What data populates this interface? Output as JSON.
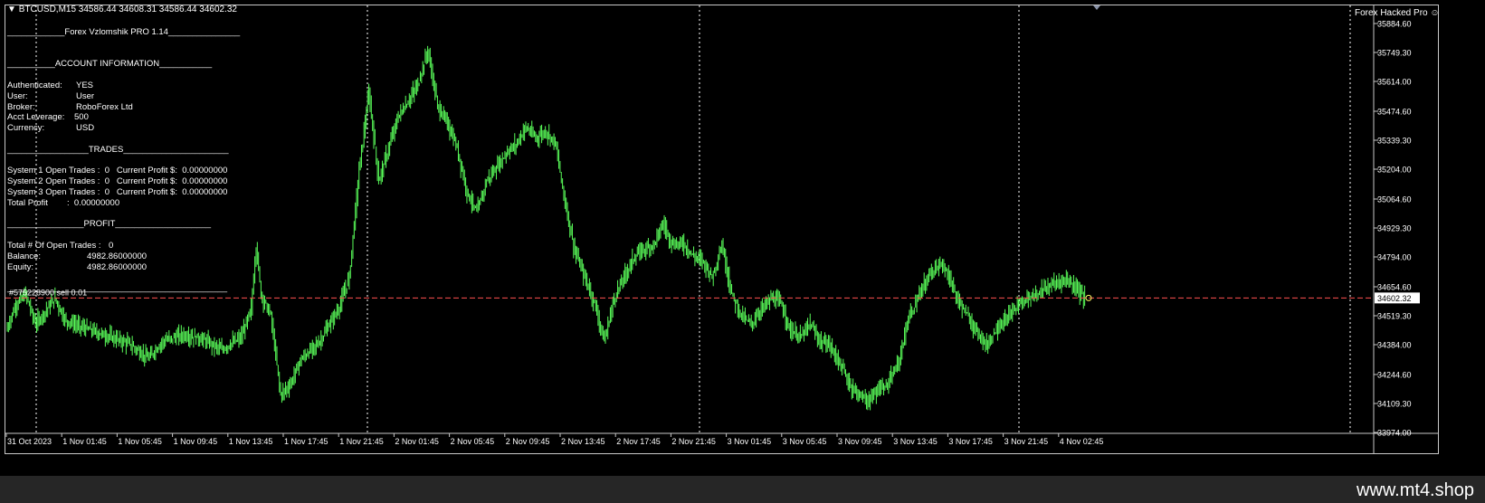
{
  "header": {
    "symbol_line": "BTCUSD,M15  34586.44 34608.31 34586.44 34602.32",
    "indicator_name": "Forex Hacked Pro",
    "indicator_icon": "smiley-icon"
  },
  "panel": {
    "title_line": "____________Forex Vzlomshik PRO 1.14_______________",
    "account_header": "__________ACCOUNT INFORMATION___________",
    "account": [
      {
        "label": "Authenticated:",
        "value": "YES"
      },
      {
        "label": "User:",
        "value": "User"
      },
      {
        "label": "Broker:",
        "value": "RoboForex Ltd"
      },
      {
        "label": "Acct Leverage:",
        "value": "500"
      },
      {
        "label": "Currency:",
        "value": "USD"
      }
    ],
    "trades_header": "_________________TRADES______________________",
    "trades": [
      "System 1 Open Trades :  0   Current Profit $:  0.00000000",
      "System 2 Open Trades :  0   Current Profit $:  0.00000000",
      "System 3 Open Trades :  0   Current Profit $:  0.00000000",
      "Total Profit        :  0.00000000"
    ],
    "profit_header": "________________PROFIT____________________",
    "profit": [
      {
        "label": "Total # Of Open Trades :",
        "value": "0"
      },
      {
        "label": "Balance:",
        "value": "4982.86000000"
      },
      {
        "label": "Equity:",
        "value": "4982.86000000"
      }
    ],
    "bottom_rule": "______________________________________________"
  },
  "order": {
    "label": "#575228900 sell 0.01",
    "price": 34602.32,
    "price_label": "34602.32",
    "line_color": "#ff5050"
  },
  "colors": {
    "background": "#000000",
    "candle": "#5aff5a",
    "grid_separator": "#ffffff",
    "price_tag_bg": "#ffffff",
    "footer_bg": "#262626"
  },
  "price_axis": {
    "ticks": [
      "35884.60",
      "35749.30",
      "35614.00",
      "35474.60",
      "35339.30",
      "35204.00",
      "35064.60",
      "34929.30",
      "34794.00",
      "34654.60",
      "34519.30",
      "34384.00",
      "34244.60",
      "34109.30",
      "33974.00"
    ],
    "min": 33974.0,
    "max": 35884.6
  },
  "time_axis": {
    "labels": [
      "31 Oct 2023",
      "1 Nov 01:45",
      "1 Nov 05:45",
      "1 Nov 09:45",
      "1 Nov 13:45",
      "1 Nov 17:45",
      "1 Nov 21:45",
      "2 Nov 01:45",
      "2 Nov 05:45",
      "2 Nov 09:45",
      "2 Nov 13:45",
      "2 Nov 17:45",
      "2 Nov 21:45",
      "3 Nov 01:45",
      "3 Nov 05:45",
      "3 Nov 09:45",
      "3 Nov 13:45",
      "3 Nov 17:45",
      "3 Nov 21:45",
      "4 Nov 02:45"
    ],
    "day_separators": [
      "1 Nov",
      "2 Nov",
      "3 Nov",
      "4 Nov",
      "5 Nov"
    ]
  },
  "chart_data": {
    "type": "line",
    "title": "BTCUSD,M15",
    "y_range": [
      33974.0,
      35884.6
    ],
    "x_start": "31 Oct 2023",
    "x_end": "4 Nov 02:45",
    "price_path": [
      [
        0,
        34450
      ],
      [
        4,
        34570
      ],
      [
        8,
        34620
      ],
      [
        12,
        34480
      ],
      [
        16,
        34540
      ],
      [
        20,
        34600
      ],
      [
        24,
        34500
      ],
      [
        30,
        34470
      ],
      [
        40,
        34430
      ],
      [
        50,
        34390
      ],
      [
        58,
        34320
      ],
      [
        64,
        34400
      ],
      [
        72,
        34430
      ],
      [
        80,
        34410
      ],
      [
        88,
        34360
      ],
      [
        96,
        34420
      ],
      [
        100,
        34550
      ],
      [
        102,
        34850
      ],
      [
        104,
        34620
      ],
      [
        108,
        34520
      ],
      [
        112,
        34150
      ],
      [
        116,
        34200
      ],
      [
        120,
        34310
      ],
      [
        128,
        34400
      ],
      [
        136,
        34560
      ],
      [
        140,
        34700
      ],
      [
        144,
        35200
      ],
      [
        148,
        35560
      ],
      [
        152,
        35150
      ],
      [
        156,
        35300
      ],
      [
        160,
        35450
      ],
      [
        164,
        35520
      ],
      [
        168,
        35600
      ],
      [
        172,
        35760
      ],
      [
        176,
        35500
      ],
      [
        180,
        35420
      ],
      [
        184,
        35300
      ],
      [
        188,
        35100
      ],
      [
        192,
        35000
      ],
      [
        196,
        35150
      ],
      [
        200,
        35210
      ],
      [
        204,
        35280
      ],
      [
        208,
        35320
      ],
      [
        212,
        35400
      ],
      [
        216,
        35350
      ],
      [
        220,
        35380
      ],
      [
        224,
        35330
      ],
      [
        228,
        35050
      ],
      [
        232,
        34820
      ],
      [
        236,
        34700
      ],
      [
        240,
        34580
      ],
      [
        244,
        34400
      ],
      [
        248,
        34600
      ],
      [
        252,
        34700
      ],
      [
        256,
        34790
      ],
      [
        260,
        34830
      ],
      [
        264,
        34850
      ],
      [
        268,
        34950
      ],
      [
        272,
        34850
      ],
      [
        276,
        34860
      ],
      [
        280,
        34800
      ],
      [
        284,
        34780
      ],
      [
        288,
        34700
      ],
      [
        292,
        34850
      ],
      [
        296,
        34620
      ],
      [
        300,
        34520
      ],
      [
        304,
        34480
      ],
      [
        308,
        34550
      ],
      [
        312,
        34600
      ],
      [
        316,
        34580
      ],
      [
        320,
        34450
      ],
      [
        324,
        34420
      ],
      [
        328,
        34480
      ],
      [
        332,
        34400
      ],
      [
        336,
        34380
      ],
      [
        340,
        34300
      ],
      [
        344,
        34200
      ],
      [
        348,
        34150
      ],
      [
        352,
        34120
      ],
      [
        356,
        34180
      ],
      [
        360,
        34200
      ],
      [
        364,
        34300
      ],
      [
        368,
        34500
      ],
      [
        372,
        34600
      ],
      [
        376,
        34700
      ],
      [
        380,
        34760
      ],
      [
        384,
        34720
      ],
      [
        388,
        34600
      ],
      [
        392,
        34520
      ],
      [
        396,
        34450
      ],
      [
        400,
        34380
      ],
      [
        404,
        34460
      ],
      [
        408,
        34500
      ],
      [
        412,
        34560
      ],
      [
        416,
        34600
      ],
      [
        420,
        34620
      ],
      [
        424,
        34650
      ],
      [
        428,
        34670
      ],
      [
        432,
        34690
      ],
      [
        436,
        34660
      ],
      [
        440,
        34602
      ]
    ]
  }
}
